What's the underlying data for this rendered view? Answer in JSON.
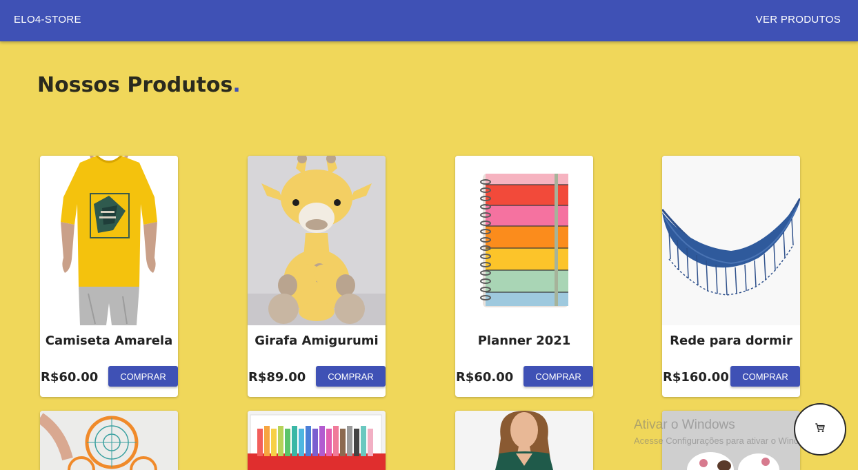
{
  "header": {
    "brand": "ELO4-STORE",
    "nav_link": "VER PRODUTOS"
  },
  "page": {
    "title": "Nossos Produtos",
    "title_dot": "."
  },
  "products": [
    {
      "name": "Camiseta Amarela",
      "price": "R$60.00",
      "button": "COMPRAR"
    },
    {
      "name": "Girafa Amigurumi",
      "price": "R$89.00",
      "button": "COMPRAR"
    },
    {
      "name": "Planner 2021",
      "price": "R$60.00",
      "button": "COMPRAR"
    },
    {
      "name": "Rede para dormir",
      "price": "R$160.00",
      "button": "COMPRAR"
    }
  ],
  "windows_watermark": {
    "title": "Ativar o Windows",
    "subtitle": "Acesse Configurações para ativar o Windows."
  },
  "colors": {
    "primary": "#3f51b5",
    "background": "#f0d75a"
  },
  "icons": {
    "cart": "shopping-cart-icon"
  }
}
